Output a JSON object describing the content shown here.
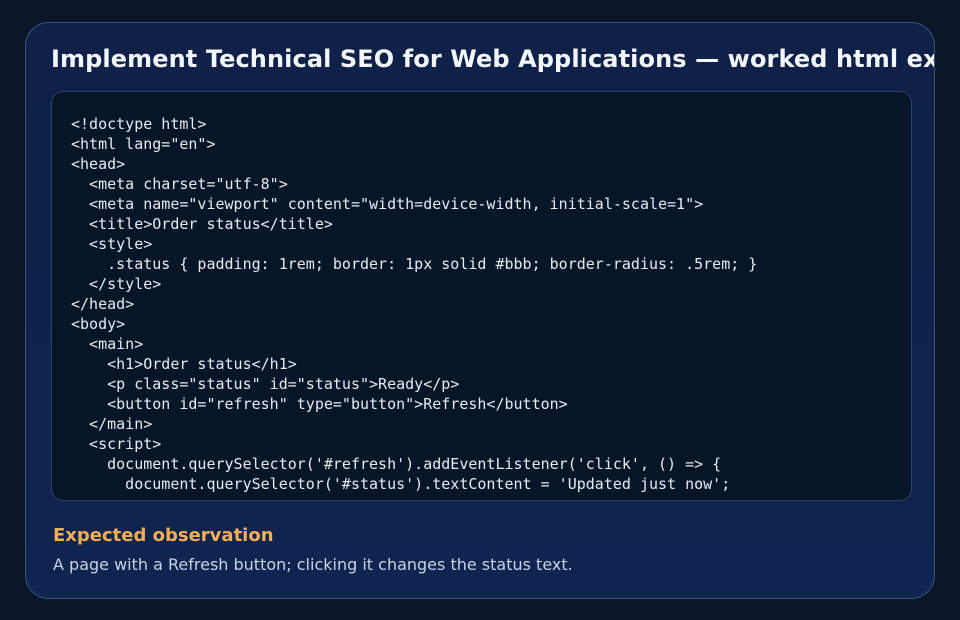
{
  "card": {
    "title": "Implement Technical SEO for Web Applications — worked html example",
    "code_lines": [
      "<!doctype html>",
      "<html lang=\"en\">",
      "<head>",
      "  <meta charset=\"utf-8\">",
      "  <meta name=\"viewport\" content=\"width=device-width, initial-scale=1\">",
      "  <title>Order status</title>",
      "  <style>",
      "    .status { padding: 1rem; border: 1px solid #bbb; border-radius: .5rem; }",
      "  </style>",
      "</head>",
      "<body>",
      "  <main>",
      "    <h1>Order status</h1>",
      "    <p class=\"status\" id=\"status\">Ready</p>",
      "    <button id=\"refresh\" type=\"button\">Refresh</button>",
      "  </main>",
      "  <script>",
      "    document.querySelector('#refresh').addEventListener('click', () => {",
      "      document.querySelector('#status').textContent = 'Updated just now';"
    ],
    "observation": {
      "heading": "Expected observation",
      "text": "A page with a Refresh button; clicking it changes the status text."
    }
  },
  "colors": {
    "page_background": "#0b1528",
    "card_background": "#0f2148",
    "code_background": "#061528",
    "accent_heading": "#f4ae58",
    "title_text": "#f3f6fb"
  }
}
